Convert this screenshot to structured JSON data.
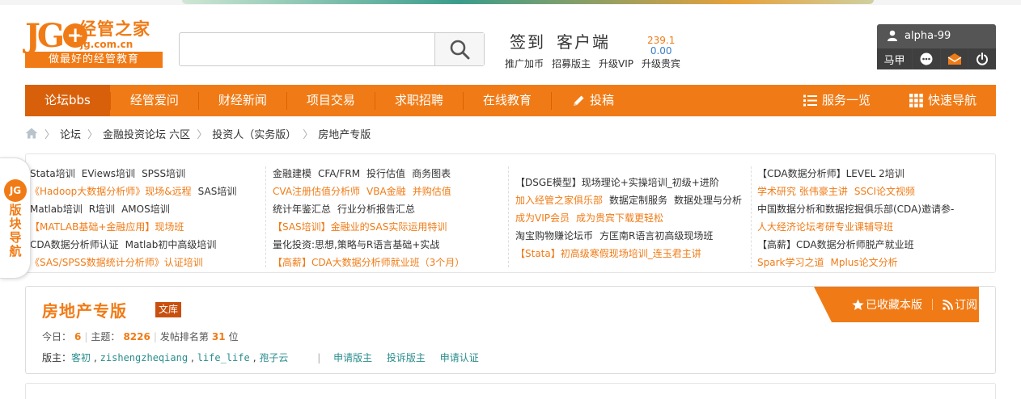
{
  "logo": {
    "letters": "JG",
    "plus": "+",
    "name": "经管之家",
    "domain": "jg.com.cn",
    "slogan": "做最好的经管教育"
  },
  "search": {
    "placeholder": ""
  },
  "header_links": {
    "sign": "签到",
    "client": "客户端",
    "score1": "239.1",
    "score2": "0.00",
    "sub": [
      "推广加币",
      "招募版主",
      "升级VIP",
      "升级贵宾"
    ]
  },
  "user": {
    "name": "alpha-99",
    "bottom": "马甲"
  },
  "nav": {
    "items": [
      "论坛bbs",
      "经管爱问",
      "财经新闻",
      "项目交易",
      "求职招聘",
      "在线教育",
      "投稿"
    ],
    "right": [
      "服务一览",
      "快速导航"
    ]
  },
  "breadcrumb": [
    "论坛",
    "金融投资论坛 六区",
    "投资人（实务版）",
    "房地产专版"
  ],
  "ads": [
    [
      [
        "Stata培训",
        "EViews培训",
        "SPSS培训"
      ],
      [
        "《Hadoop大数据分析师》现场&远程",
        "SAS培训"
      ],
      [
        "Matlab培训",
        "R培训",
        "AMOS培训"
      ],
      [
        "【MATLAB基础+金融应用】现场班"
      ],
      [
        "CDA数据分析师认证",
        "Matlab初中高级培训"
      ],
      [
        "《SAS/SPSS数据统计分析师》认证培训"
      ]
    ],
    [
      [
        "金融建模",
        "CFA/FRM",
        "投行估值",
        "商务图表"
      ],
      [
        "CVA注册估值分析师",
        "VBA金融",
        "并购估值"
      ],
      [
        "统计年鉴汇总",
        "行业分析报告汇总"
      ],
      [
        "【SAS培训】金融业的SAS实际运用特训"
      ],
      [
        "量化投资:思想,策略与R语言基础+实战"
      ],
      [
        "【高薪】CDA大数据分析师就业班（3个月）"
      ]
    ],
    [
      [
        "【DSGE模型】现场理论+实操培训_初级+进阶"
      ],
      [
        "加入经管之家俱乐部",
        "数据定制服务",
        "数据处理与分析"
      ],
      [
        "成为VIP会员",
        "成为贵宾下载更轻松"
      ],
      [
        "淘宝购物赚论坛币",
        "方匡南R语言初高级现场班"
      ],
      [
        "【Stata】初高级寒假现场培训_连玉君主讲"
      ]
    ],
    [
      [
        "【CDA数据分析师】LEVEL 2培训"
      ],
      [
        "学术研究 张伟豪主讲",
        "SSCI论文视频"
      ],
      [
        "中国数据分析和数据挖掘俱乐部(CDA)邀请参-"
      ],
      [
        "人大经济论坛考研专业课辅导班"
      ],
      [
        "【高薪】CDA数据分析师脱产就业班"
      ],
      [
        "Spark学习之道",
        "Mplus论文分析"
      ]
    ]
  ],
  "sidetab": {
    "circle": "JG",
    "text": "版块导航"
  },
  "forum": {
    "title": "房地产专版",
    "badge": "文库",
    "today_label": "今日：",
    "today": "6",
    "topic_label": "主题：",
    "topics": "8226",
    "rank_label": "发帖排名第",
    "rank": "31",
    "rank_suffix": "位",
    "mod_label": "版主：",
    "mods": [
      "客初",
      "zishengzheqiang",
      "life_life",
      "孢子云"
    ],
    "actions": [
      "申请版主",
      "投诉版主",
      "申请认证"
    ],
    "fav": "已收藏本版",
    "rss": "订阅"
  },
  "colors": {
    "brand": "#f07b16",
    "nav_active": "#d9600a",
    "mod_link": "#2a8c8c"
  }
}
